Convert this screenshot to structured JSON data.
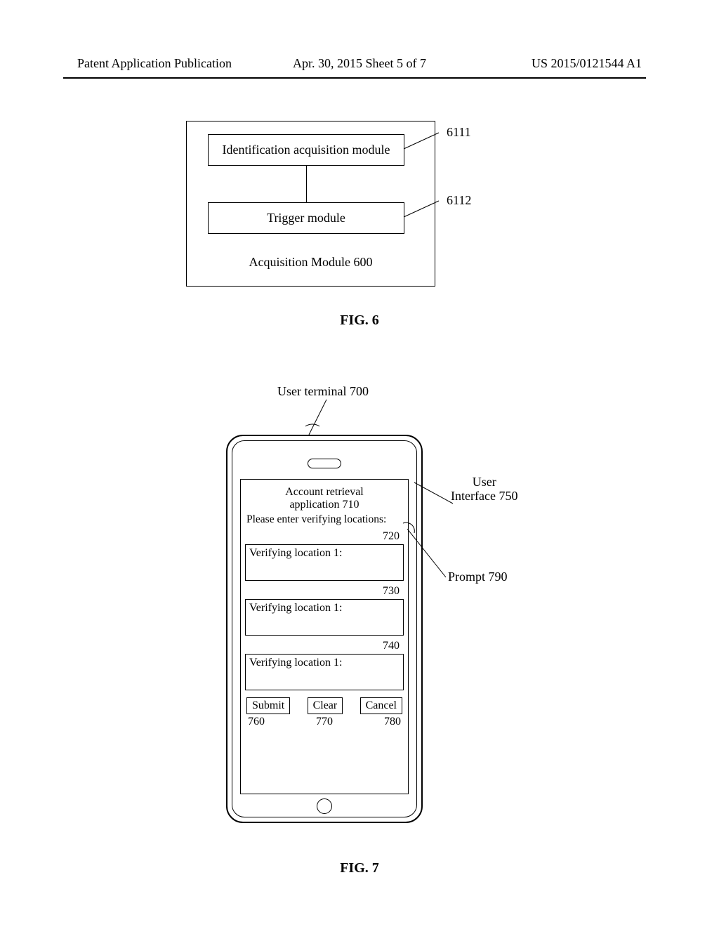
{
  "page_header": {
    "left": "Patent Application Publication",
    "center": "Apr. 30, 2015  Sheet 5 of 7",
    "right": "US 2015/0121544 A1"
  },
  "fig6": {
    "container_caption": "Acquisition Module 600",
    "box_a": "Identification acquisition module",
    "box_a_ref": "6111",
    "box_b": "Trigger module",
    "box_b_ref": "6112",
    "figure_label": "FIG. 6"
  },
  "fig7": {
    "title": "User terminal 700",
    "app_title_line1": "Account retrieval",
    "app_title_line2": "application 710",
    "prompt": "Please enter verifying locations:",
    "field1_label": "Verifying location 1:",
    "field1_ref": "720",
    "field2_label": "Verifying location 1:",
    "field2_ref": "730",
    "field3_label": "Verifying location 1:",
    "field3_ref": "740",
    "submit": "Submit",
    "clear": "Clear",
    "cancel": "Cancel",
    "submit_ref": "760",
    "clear_ref": "770",
    "cancel_ref": "780",
    "callout_ui_line1": "User",
    "callout_ui_line2": "Interface 750",
    "callout_prompt": "Prompt 790",
    "figure_label": "FIG. 7"
  }
}
